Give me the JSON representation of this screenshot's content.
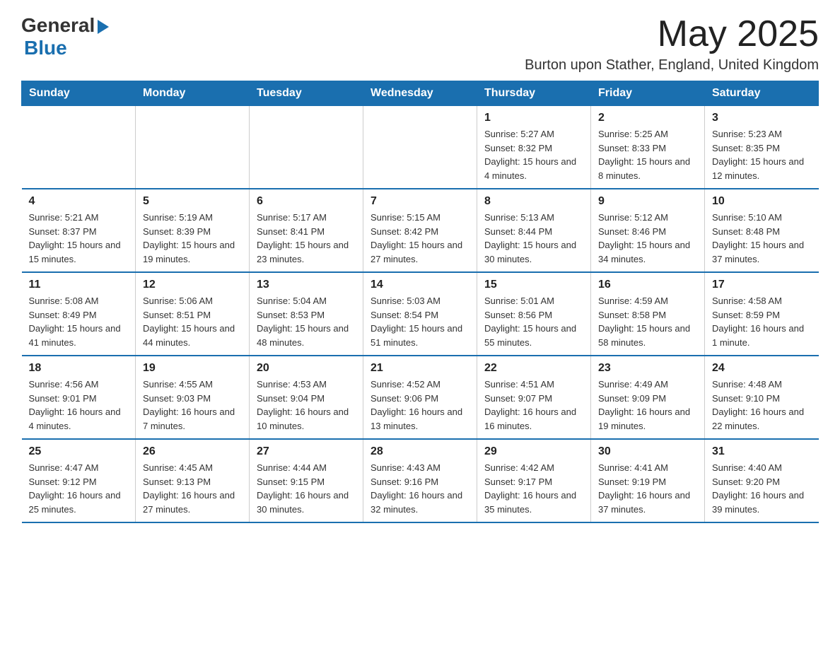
{
  "logo": {
    "general": "General",
    "arrow": "▶",
    "blue": "Blue"
  },
  "header": {
    "title": "May 2025",
    "subtitle": "Burton upon Stather, England, United Kingdom"
  },
  "weekdays": [
    "Sunday",
    "Monday",
    "Tuesday",
    "Wednesday",
    "Thursday",
    "Friday",
    "Saturday"
  ],
  "weeks": [
    [
      {
        "day": "",
        "info": ""
      },
      {
        "day": "",
        "info": ""
      },
      {
        "day": "",
        "info": ""
      },
      {
        "day": "",
        "info": ""
      },
      {
        "day": "1",
        "info": "Sunrise: 5:27 AM\nSunset: 8:32 PM\nDaylight: 15 hours and 4 minutes."
      },
      {
        "day": "2",
        "info": "Sunrise: 5:25 AM\nSunset: 8:33 PM\nDaylight: 15 hours and 8 minutes."
      },
      {
        "day": "3",
        "info": "Sunrise: 5:23 AM\nSunset: 8:35 PM\nDaylight: 15 hours and 12 minutes."
      }
    ],
    [
      {
        "day": "4",
        "info": "Sunrise: 5:21 AM\nSunset: 8:37 PM\nDaylight: 15 hours and 15 minutes."
      },
      {
        "day": "5",
        "info": "Sunrise: 5:19 AM\nSunset: 8:39 PM\nDaylight: 15 hours and 19 minutes."
      },
      {
        "day": "6",
        "info": "Sunrise: 5:17 AM\nSunset: 8:41 PM\nDaylight: 15 hours and 23 minutes."
      },
      {
        "day": "7",
        "info": "Sunrise: 5:15 AM\nSunset: 8:42 PM\nDaylight: 15 hours and 27 minutes."
      },
      {
        "day": "8",
        "info": "Sunrise: 5:13 AM\nSunset: 8:44 PM\nDaylight: 15 hours and 30 minutes."
      },
      {
        "day": "9",
        "info": "Sunrise: 5:12 AM\nSunset: 8:46 PM\nDaylight: 15 hours and 34 minutes."
      },
      {
        "day": "10",
        "info": "Sunrise: 5:10 AM\nSunset: 8:48 PM\nDaylight: 15 hours and 37 minutes."
      }
    ],
    [
      {
        "day": "11",
        "info": "Sunrise: 5:08 AM\nSunset: 8:49 PM\nDaylight: 15 hours and 41 minutes."
      },
      {
        "day": "12",
        "info": "Sunrise: 5:06 AM\nSunset: 8:51 PM\nDaylight: 15 hours and 44 minutes."
      },
      {
        "day": "13",
        "info": "Sunrise: 5:04 AM\nSunset: 8:53 PM\nDaylight: 15 hours and 48 minutes."
      },
      {
        "day": "14",
        "info": "Sunrise: 5:03 AM\nSunset: 8:54 PM\nDaylight: 15 hours and 51 minutes."
      },
      {
        "day": "15",
        "info": "Sunrise: 5:01 AM\nSunset: 8:56 PM\nDaylight: 15 hours and 55 minutes."
      },
      {
        "day": "16",
        "info": "Sunrise: 4:59 AM\nSunset: 8:58 PM\nDaylight: 15 hours and 58 minutes."
      },
      {
        "day": "17",
        "info": "Sunrise: 4:58 AM\nSunset: 8:59 PM\nDaylight: 16 hours and 1 minute."
      }
    ],
    [
      {
        "day": "18",
        "info": "Sunrise: 4:56 AM\nSunset: 9:01 PM\nDaylight: 16 hours and 4 minutes."
      },
      {
        "day": "19",
        "info": "Sunrise: 4:55 AM\nSunset: 9:03 PM\nDaylight: 16 hours and 7 minutes."
      },
      {
        "day": "20",
        "info": "Sunrise: 4:53 AM\nSunset: 9:04 PM\nDaylight: 16 hours and 10 minutes."
      },
      {
        "day": "21",
        "info": "Sunrise: 4:52 AM\nSunset: 9:06 PM\nDaylight: 16 hours and 13 minutes."
      },
      {
        "day": "22",
        "info": "Sunrise: 4:51 AM\nSunset: 9:07 PM\nDaylight: 16 hours and 16 minutes."
      },
      {
        "day": "23",
        "info": "Sunrise: 4:49 AM\nSunset: 9:09 PM\nDaylight: 16 hours and 19 minutes."
      },
      {
        "day": "24",
        "info": "Sunrise: 4:48 AM\nSunset: 9:10 PM\nDaylight: 16 hours and 22 minutes."
      }
    ],
    [
      {
        "day": "25",
        "info": "Sunrise: 4:47 AM\nSunset: 9:12 PM\nDaylight: 16 hours and 25 minutes."
      },
      {
        "day": "26",
        "info": "Sunrise: 4:45 AM\nSunset: 9:13 PM\nDaylight: 16 hours and 27 minutes."
      },
      {
        "day": "27",
        "info": "Sunrise: 4:44 AM\nSunset: 9:15 PM\nDaylight: 16 hours and 30 minutes."
      },
      {
        "day": "28",
        "info": "Sunrise: 4:43 AM\nSunset: 9:16 PM\nDaylight: 16 hours and 32 minutes."
      },
      {
        "day": "29",
        "info": "Sunrise: 4:42 AM\nSunset: 9:17 PM\nDaylight: 16 hours and 35 minutes."
      },
      {
        "day": "30",
        "info": "Sunrise: 4:41 AM\nSunset: 9:19 PM\nDaylight: 16 hours and 37 minutes."
      },
      {
        "day": "31",
        "info": "Sunrise: 4:40 AM\nSunset: 9:20 PM\nDaylight: 16 hours and 39 minutes."
      }
    ]
  ]
}
